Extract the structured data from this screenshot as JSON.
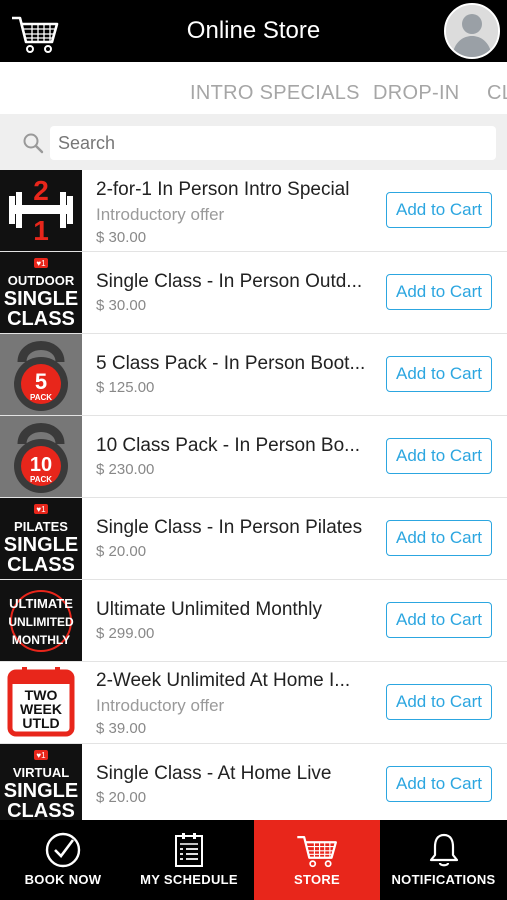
{
  "header": {
    "title": "Online Store"
  },
  "tabs": [
    {
      "label": "INTRO SPECIALS"
    },
    {
      "label": "DROP-IN"
    },
    {
      "label": "CL"
    }
  ],
  "search": {
    "placeholder": "Search"
  },
  "products": [
    {
      "name": "2-for-1 In Person Intro Special",
      "subtitle": "Introductory offer",
      "price": "$ 30.00",
      "button": "Add to Cart",
      "thumb_text": "2 1",
      "thumb_icon": "dumbbell-icon"
    },
    {
      "name": "Single Class - In Person Outd...",
      "subtitle": "",
      "price": "$ 30.00",
      "button": "Add to Cart",
      "thumb_text": [
        "OUTDOOR",
        "SINGLE",
        "CLASS"
      ],
      "thumb_icon": "outdoor-single-class-icon"
    },
    {
      "name": "5 Class Pack - In Person Boot...",
      "subtitle": "",
      "price": "$ 125.00",
      "button": "Add to Cart",
      "thumb_text": [
        "5",
        "PACK"
      ],
      "thumb_icon": "kettlebell-5-pack-icon"
    },
    {
      "name": "10 Class Pack - In Person Bo...",
      "subtitle": "",
      "price": "$ 230.00",
      "button": "Add to Cart",
      "thumb_text": [
        "10",
        "PACK"
      ],
      "thumb_icon": "kettlebell-10-pack-icon"
    },
    {
      "name": "Single Class - In Person Pilates",
      "subtitle": "",
      "price": "$ 20.00",
      "button": "Add to Cart",
      "thumb_text": [
        "PILATES",
        "SINGLE",
        "CLASS"
      ],
      "thumb_icon": "pilates-single-class-icon"
    },
    {
      "name": "Ultimate Unlimited Monthly",
      "subtitle": "",
      "price": "$ 299.00",
      "button": "Add to Cart",
      "thumb_text": [
        "ULTIMATE",
        "UNLIMITED",
        "MONTHLY"
      ],
      "thumb_icon": "ultimate-unlimited-monthly-icon"
    },
    {
      "name": "2-Week Unlimited At Home I...",
      "subtitle": "Introductory offer",
      "price": "$ 39.00",
      "button": "Add to Cart",
      "thumb_text": [
        "TWO",
        "WEEK",
        "UTLD"
      ],
      "thumb_icon": "calendar-two-week-icon"
    },
    {
      "name": "Single Class - At Home Live",
      "subtitle": "",
      "price": "$ 20.00",
      "button": "Add to Cart",
      "thumb_text": [
        "VIRTUAL",
        "SINGLE",
        "CLASS"
      ],
      "thumb_icon": "virtual-single-class-icon"
    }
  ],
  "bottom_nav": [
    {
      "label": "BOOK NOW",
      "icon": "checkmark-circle-icon"
    },
    {
      "label": "MY SCHEDULE",
      "icon": "schedule-list-icon"
    },
    {
      "label": "STORE",
      "icon": "cart-icon",
      "active": true
    },
    {
      "label": "NOTIFICATIONS",
      "icon": "bell-icon"
    }
  ],
  "colors": {
    "accent": "#2ca6e0",
    "active_tab": "#e8261b",
    "header_bg": "#000000",
    "brand_red": "#e8261b"
  }
}
